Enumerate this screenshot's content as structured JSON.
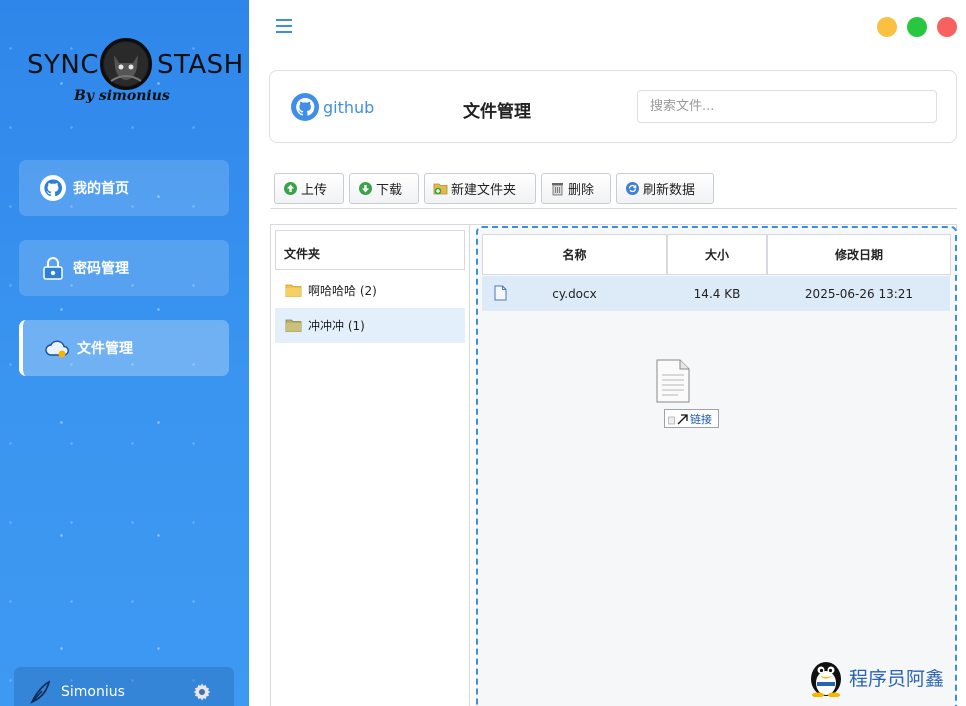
{
  "app": {
    "logo_left": "SYNC",
    "logo_right": "STASH",
    "logo_by": "By simonius"
  },
  "sidebar": {
    "items": [
      {
        "label": "我的首页",
        "icon": "github-icon"
      },
      {
        "label": "密码管理",
        "icon": "lock-icon"
      },
      {
        "label": "文件管理",
        "icon": "cloud-icon",
        "active": true
      }
    ],
    "user": {
      "name": "Simonius",
      "avatar_icon": "feather-icon",
      "settings_icon": "gear-icon"
    }
  },
  "header": {
    "github_label": "github",
    "title": "文件管理",
    "search_placeholder": "搜索文件..."
  },
  "window_controls": {
    "minimize": "#f9c041",
    "maximize": "#27c840",
    "close": "#f96161"
  },
  "toolbar": {
    "upload": "上传",
    "download": "下载",
    "new_folder": "新建文件夹",
    "delete": "删除",
    "refresh": "刷新数据"
  },
  "folders": {
    "header": "文件夹",
    "items": [
      {
        "label": "啊哈哈哈 (2)",
        "selected": false
      },
      {
        "label": "冲冲冲 (1)",
        "selected": true
      }
    ]
  },
  "files": {
    "columns": {
      "name": "名称",
      "size": "大小",
      "modified": "修改日期"
    },
    "rows": [
      {
        "name": "cy.docx",
        "size": "14.4 KB",
        "modified": "2025-06-26 13:21"
      }
    ]
  },
  "drag": {
    "tooltip": "链接"
  },
  "watermark": {
    "text": "程序员阿鑫"
  },
  "colors": {
    "accent": "#3b8fe0",
    "sidebar": "#3a95f0",
    "selected_row": "#ddebf8"
  }
}
